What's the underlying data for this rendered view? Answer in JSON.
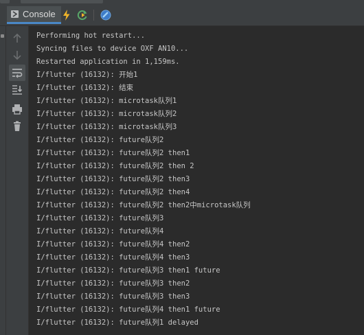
{
  "window": {
    "tab_label": "Console"
  },
  "toolbar": {
    "icons": [
      "console-icon",
      "hot-reload-icon",
      "hot-restart-icon",
      "dart-devtools-icon"
    ]
  },
  "gutter": {
    "icons": [
      "up-arrow-icon",
      "down-arrow-icon",
      "soft-wrap-icon",
      "scroll-to-end-icon",
      "print-icon",
      "trash-icon"
    ]
  },
  "colors": {
    "background": "#2b2b2b",
    "panel": "#3c3f41",
    "text": "#c6c6c6",
    "accent": "#4a88c7",
    "hot_reload": "#f0b429",
    "hot_restart": "#59a869"
  },
  "console": {
    "lines": [
      "Performing hot restart...",
      "Syncing files to device OXF AN10...",
      "Restarted application in 1,159ms.",
      "I/flutter (16132): 开始1",
      "I/flutter (16132): 结束",
      "I/flutter (16132): microtask队列1",
      "I/flutter (16132): microtask队列2",
      "I/flutter (16132): microtask队列3",
      "I/flutter (16132): future队列2",
      "I/flutter (16132): future队列2 then1",
      "I/flutter (16132): future队列2 then 2",
      "I/flutter (16132): future队列2 then3",
      "I/flutter (16132): future队列2 then4",
      "I/flutter (16132): future队列2 then2中microtask队列",
      "I/flutter (16132): future队列3",
      "I/flutter (16132): future队列4",
      "I/flutter (16132): future队列4 then2",
      "I/flutter (16132): future队列4 then3",
      "I/flutter (16132): future队列3 then1 future",
      "I/flutter (16132): future队列3 then2",
      "I/flutter (16132): future队列3 then3",
      "I/flutter (16132): future队列4 then1 future",
      "I/flutter (16132): future队列1 delayed"
    ]
  }
}
